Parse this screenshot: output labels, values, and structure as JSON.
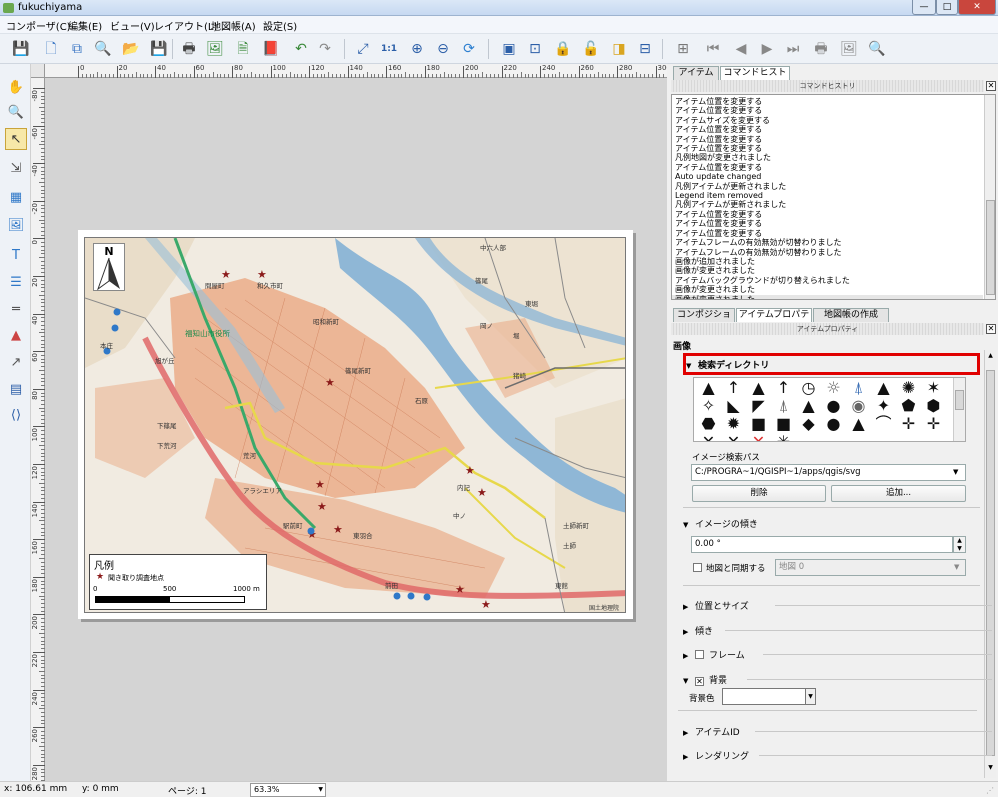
{
  "window": {
    "title": "fukuchiyama",
    "min": "—",
    "max": "□",
    "close": "✕"
  },
  "menu": [
    "コンポーザ(C)",
    "編集(E)",
    "ビュー(V)",
    "レイアウト(L)",
    "地図帳(A)",
    "設定(S)"
  ],
  "toolbar_icons": [
    "save-icon",
    "new-composer-icon",
    "duplicate-composer-icon",
    "composer-manager-icon",
    "open-template-icon",
    "save-template-icon",
    "print-icon",
    "export-image-icon",
    "export-svg-icon",
    "export-pdf-icon",
    "undo-icon",
    "redo-icon",
    "zoom-full-icon",
    "zoom-actual-icon",
    "zoom-in-icon",
    "zoom-out-icon",
    "refresh-icon",
    "group-icon",
    "ungroup-icon",
    "lock-icon",
    "unlock-icon",
    "raise-icon",
    "align-icon",
    "atlas-preview-icon",
    "first-feature-icon",
    "previous-feature-icon",
    "next-feature-icon",
    "last-feature-icon",
    "atlas-print-icon",
    "atlas-export-icon",
    "atlas-settings-icon"
  ],
  "toolbar_glyphs": [
    "💾",
    "🗋",
    "⧉",
    "🔍",
    "📂",
    "💾",
    "🖶",
    "🖼",
    "🗎",
    "📕",
    "↶",
    "↷",
    "⤢",
    "1:1",
    "⊕",
    "⊖",
    "⟳",
    "▣",
    "⊡",
    "🔒",
    "🔓",
    "◨",
    "⊟",
    "⊞",
    "⏮",
    "◀",
    "▶",
    "⏭",
    "🖶",
    "🖼",
    "🔍"
  ],
  "left_tools": [
    {
      "name": "pan-icon",
      "glyph": "✋"
    },
    {
      "name": "zoom-tool-icon",
      "glyph": "🔍"
    },
    {
      "name": "select-move-item-icon",
      "glyph": "↖"
    },
    {
      "name": "move-content-icon",
      "glyph": "⇲"
    },
    {
      "name": "add-map-icon",
      "glyph": "▦"
    },
    {
      "name": "add-image-icon",
      "glyph": "🖼"
    },
    {
      "name": "add-label-icon",
      "glyph": "T"
    },
    {
      "name": "add-legend-icon",
      "glyph": "☰"
    },
    {
      "name": "add-scalebar-icon",
      "glyph": "═"
    },
    {
      "name": "add-shape-icon",
      "glyph": "▲"
    },
    {
      "name": "add-arrow-icon",
      "glyph": "↗"
    },
    {
      "name": "add-attribute-table-icon",
      "glyph": "▤"
    },
    {
      "name": "add-html-icon",
      "glyph": "⟨⟩"
    }
  ],
  "ruler_h": [
    "0",
    "20",
    "40",
    "60",
    "80",
    "100",
    "120",
    "140",
    "160",
    "180",
    "200",
    "220",
    "240",
    "260",
    "280",
    "300"
  ],
  "ruler_v": [
    "-80",
    "-60",
    "-40",
    "-20",
    "0",
    "20",
    "40",
    "60",
    "80",
    "100",
    "120",
    "140",
    "160",
    "180",
    "200",
    "220",
    "240",
    "260",
    "280"
  ],
  "map": {
    "north_label": "N",
    "place_labels": [
      "中六人部",
      "篠尾",
      "和久市町",
      "問屋町",
      "福知山市役所",
      "東堀",
      "昭和新町",
      "岡ノ",
      "堀",
      "猪崎",
      "下篠尾",
      "本庄",
      "旭が丘",
      "下荒河",
      "荒河",
      "篠尾新町",
      "石原",
      "駅前町",
      "東羽合",
      "内記",
      "土師新町",
      "土師",
      "中ノ",
      "アラシエリア",
      "前田",
      "東館",
      "長田"
    ],
    "credit": "国土地理院"
  },
  "legend": {
    "title": "凡例",
    "item": "聞き取り調査地点",
    "scale_0": "0",
    "scale_mid": "500",
    "scale_end": "1000 m"
  },
  "panel": {
    "top_tabs": [
      "アイテム",
      "コマンドヒストリ"
    ],
    "history_header": "コマンドヒストリ",
    "history": [
      "アイテム位置を変更する",
      "アイテム位置を変更する",
      "アイテムサイズを変更する",
      "アイテム位置を変更する",
      "アイテム位置を変更する",
      "アイテム位置を変更する",
      "凡例地図が変更されました",
      "アイテム位置を変更する",
      "Auto update changed",
      "凡例アイテムが更新されました",
      "Legend item removed",
      "凡例アイテムが更新されました",
      "アイテム位置を変更する",
      "アイテム位置を変更する",
      "アイテム位置を変更する",
      "アイテムフレームの有効無効が切替わりました",
      "アイテムフレームの有効無効が切替わりました",
      "画像が追加されました",
      "画像が変更されました",
      "アイテムバックグラウンドが切り替えられました",
      "画像が変更されました",
      "画像が変更されました"
    ],
    "mid_tabs": [
      "コンポジション",
      "アイテムプロパティ",
      "地図帳の作成"
    ],
    "props_header": "アイテムプロパティ",
    "section_title": "画像",
    "search_dir": "検索ディレクトリ",
    "image_search_path_label": "イメージ検索パス",
    "image_search_path": "C:/PROGRA~1/QGISPI~1/apps/qgis/svg",
    "delete_btn": "削除",
    "add_btn": "追加...",
    "rotation_title": "イメージの傾き",
    "rotation_value": "0.00 °",
    "sync_map_label": "地図と同期する",
    "sync_map_value": "地図 0",
    "position_size": "位置とサイズ",
    "rotation": "傾き",
    "frame": "フレーム",
    "background": "背景",
    "bg_color_label": "背景色",
    "item_id": "アイテムID",
    "rendering": "レンダリング"
  },
  "symbols": [
    "▲",
    "↑",
    "▲",
    "↑",
    "◷",
    "☼",
    "⍋",
    "▲",
    "✺",
    "✶",
    "✧",
    "◣",
    "◤",
    "⍋",
    "▲",
    "●",
    "◉",
    "✦",
    "⬟",
    "⬢",
    "⬣",
    "✹",
    "■",
    "■",
    "◆",
    "●",
    "▲",
    "⌒",
    "✛",
    "✛",
    "✕",
    "✕",
    "✕",
    "✳"
  ],
  "status": {
    "x": "x: 106.61 mm",
    "y": "y: 0 mm",
    "page": "ページ: 1",
    "zoom": "63.3%"
  },
  "colors": {
    "highlight": "#e00000",
    "map_bg": "#f1ebe1",
    "river": "#8fb7d6",
    "urban": "#e9a47c",
    "route": "#e06868",
    "yellow_road": "#e7d84b"
  }
}
